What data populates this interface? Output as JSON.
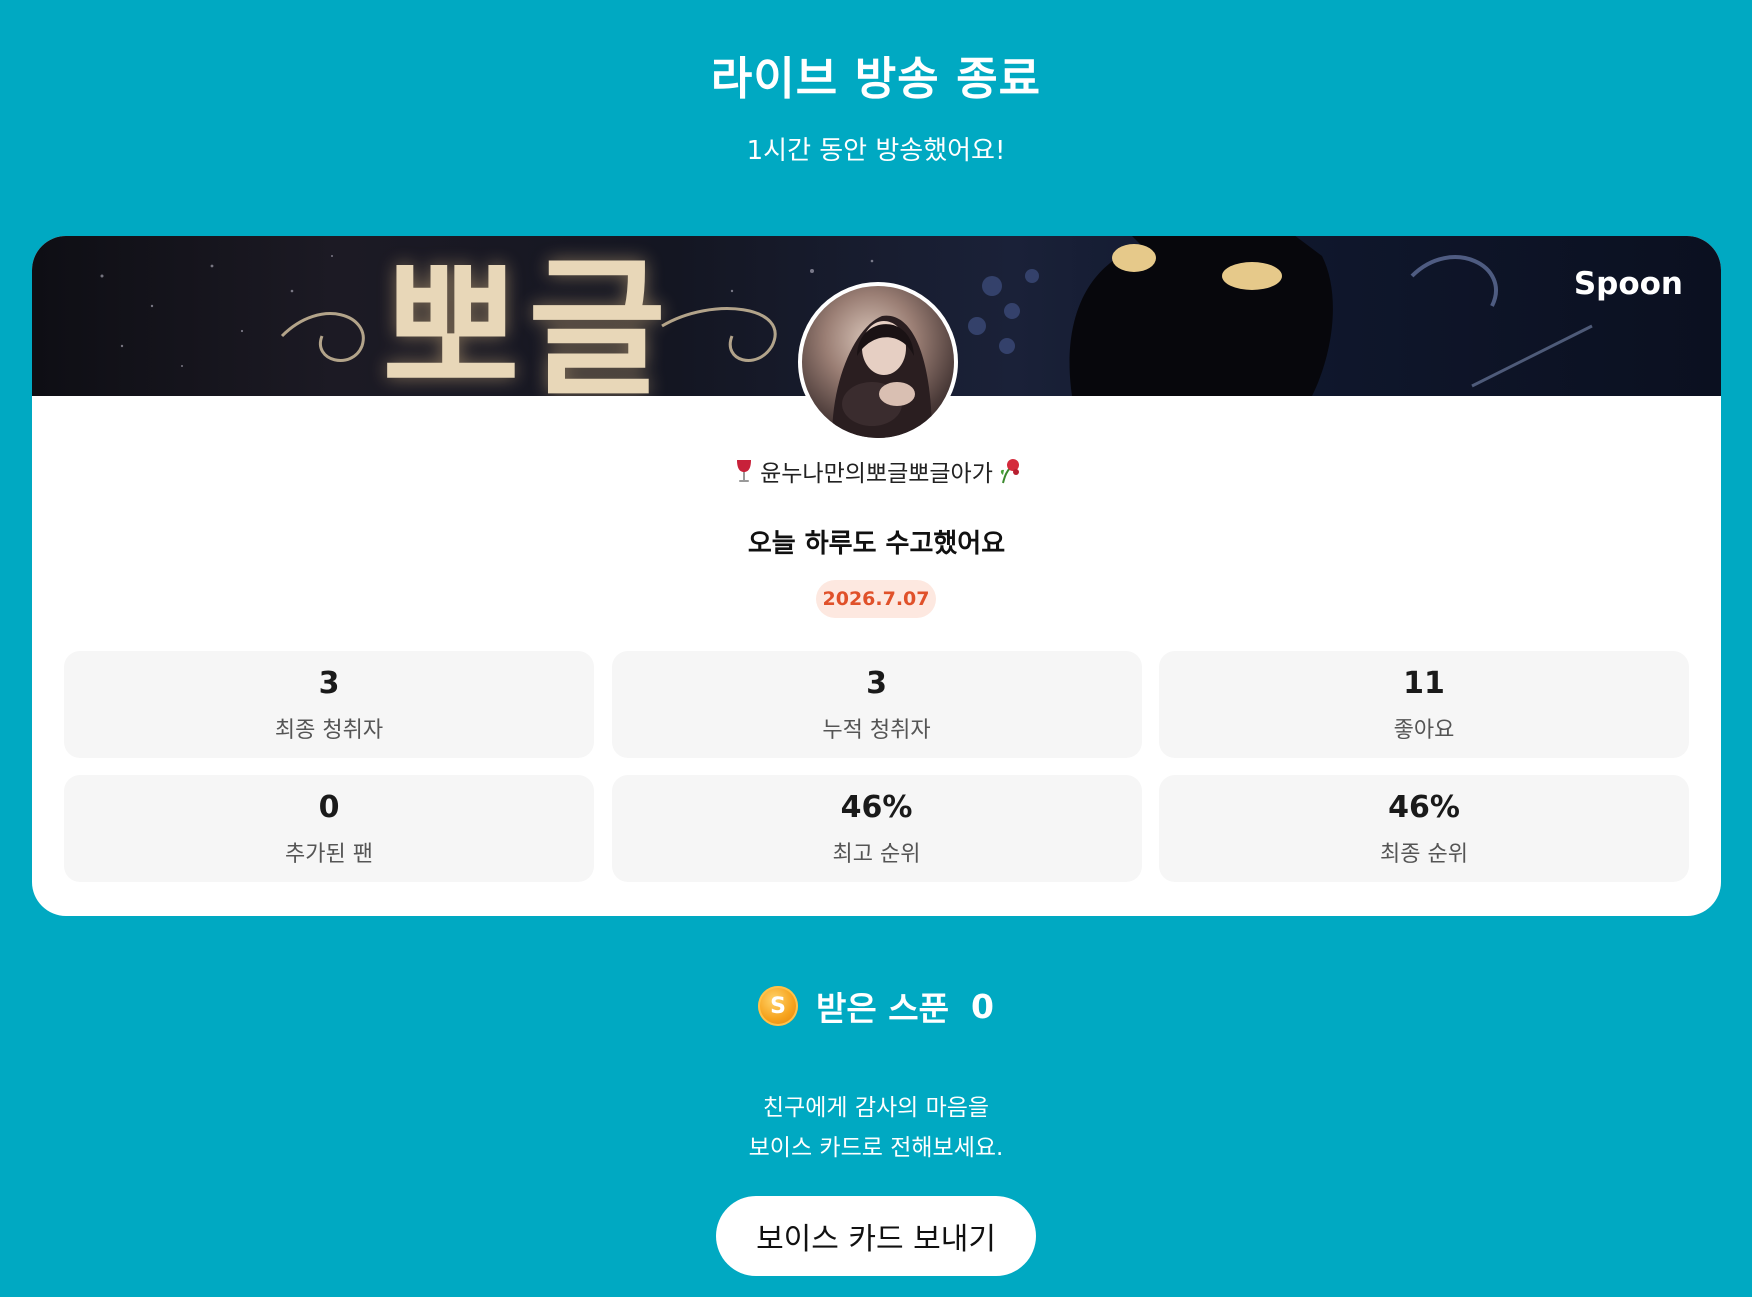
{
  "header": {
    "title": "라이브 방송 종료",
    "subtitle": "1시간 동안 방송했어요!"
  },
  "card": {
    "brand": "Spoon",
    "banner_title": "뽀글",
    "nickname": "윤누나만의뽀글뽀글아가",
    "message": "오늘 하루도 수고했어요",
    "date": "2026.7.07",
    "stats": [
      {
        "value": "3",
        "label": "최종 청취자"
      },
      {
        "value": "3",
        "label": "누적 청취자"
      },
      {
        "value": "11",
        "label": "좋아요"
      },
      {
        "value": "0",
        "label": "추가된 팬"
      },
      {
        "value": "46%",
        "label": "최고 순위"
      },
      {
        "value": "46%",
        "label": "최종 순위"
      }
    ]
  },
  "spoon": {
    "coin_letter": "S",
    "label": "받은 스푼",
    "count": "0"
  },
  "thanks": {
    "line1": "친구에게 감사의 마음을",
    "line2": "보이스 카드로 전해보세요."
  },
  "voice_card_button": "보이스 카드 보내기",
  "colors": {
    "background": "#00a9c2",
    "date_text": "#e0512a",
    "date_badge": "#fde8e0",
    "stat_tile": "#f6f6f6"
  }
}
